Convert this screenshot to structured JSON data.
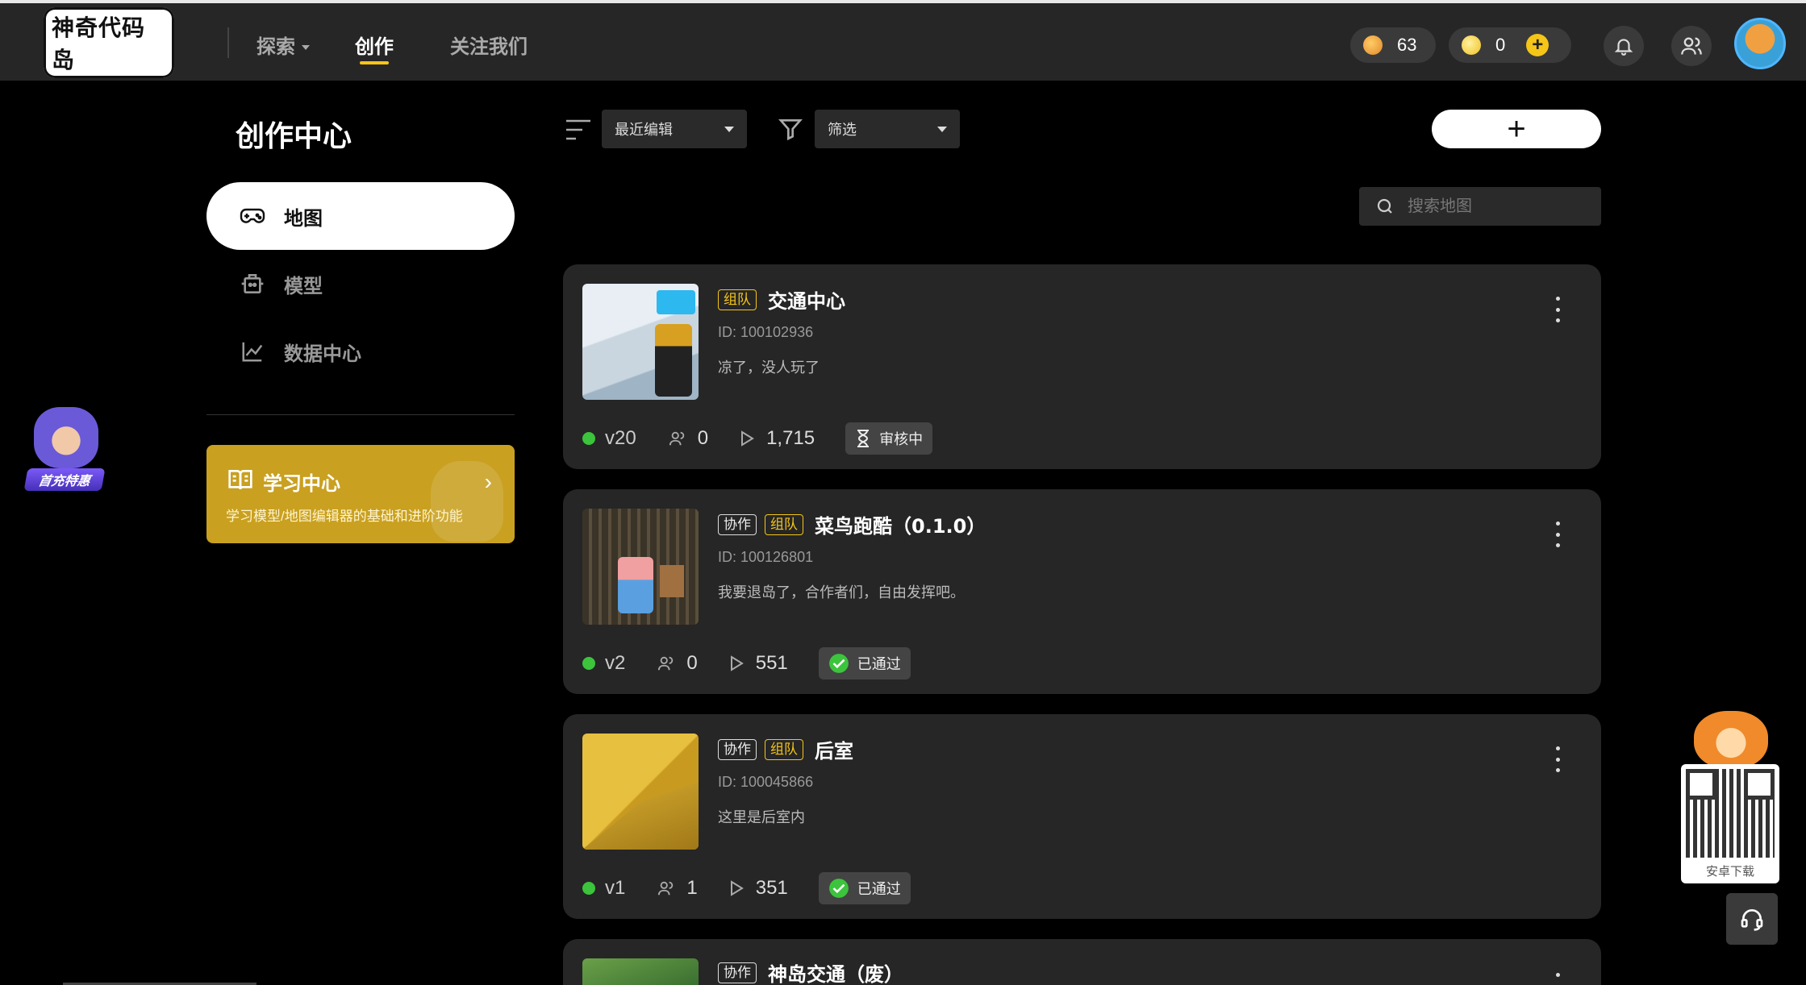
{
  "header": {
    "logo_text": "神奇代码岛",
    "nav": [
      {
        "label": "探索",
        "has_dropdown": true,
        "active": false
      },
      {
        "label": "创作",
        "has_dropdown": false,
        "active": true
      },
      {
        "label": "关注我们",
        "has_dropdown": false,
        "active": false
      }
    ],
    "currency_fish": "63",
    "currency_coin": "0",
    "icons": {
      "fish": "fish-icon",
      "coin": "coin-icon",
      "add": "plus-icon",
      "bell": "bell-icon",
      "friends": "users-icon",
      "avatar": "user-avatar"
    }
  },
  "sidebar": {
    "title": "创作中心",
    "items": [
      {
        "label": "地图",
        "icon": "gamepad-icon",
        "active": true
      },
      {
        "label": "模型",
        "icon": "model-icon",
        "active": false
      },
      {
        "label": "数据中心",
        "icon": "chart-icon",
        "active": false
      }
    ],
    "learn": {
      "title": "学习中心",
      "desc": "学习模型/地图编辑器的基础和进阶功能"
    },
    "promo_label": "首充特惠"
  },
  "toolbar": {
    "sort_value": "最近编辑",
    "filter_value": "筛选",
    "add_label": "+",
    "search_placeholder": "搜索地图"
  },
  "maps": [
    {
      "tags": [
        "组队"
      ],
      "title": "交通中心",
      "id": "ID: 100102936",
      "desc": "凉了，没人玩了",
      "version": "v20",
      "players": "0",
      "plays": "1,715",
      "status": "审核中",
      "status_type": "pending"
    },
    {
      "tags": [
        "协作",
        "组队"
      ],
      "title": "菜鸟跑酷（0.1.0）",
      "id": "ID: 100126801",
      "desc": "我要退岛了，合作者们，自由发挥吧。",
      "version": "v2",
      "players": "0",
      "plays": "551",
      "status": "已通过",
      "status_type": "approved"
    },
    {
      "tags": [
        "协作",
        "组队"
      ],
      "title": "后室",
      "id": "ID: 100045866",
      "desc": "这里是后室内",
      "version": "v1",
      "players": "1",
      "plays": "351",
      "status": "已通过",
      "status_type": "approved"
    },
    {
      "tags": [
        "协作"
      ],
      "title": "神岛交通（废）"
    }
  ],
  "floating": {
    "qr_label": "安卓下载"
  },
  "colors": {
    "accent": "#f5c518",
    "card_bg": "#262626",
    "online": "#3cc43c",
    "approved": "#3cc43c"
  }
}
